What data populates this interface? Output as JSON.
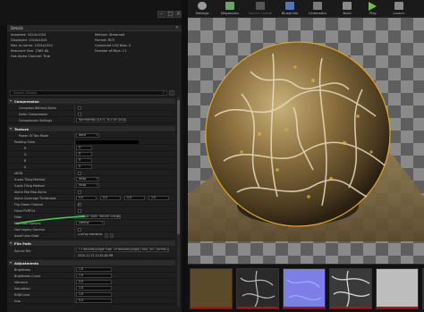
{
  "details_tab": {
    "title": "Details"
  },
  "info": {
    "imported": "Imported: 1024x1024",
    "displayed": "Displayed: 1024x1024",
    "max_ingame": "Max In-Game: 1024x1024",
    "resource_size": "Resource Size: 1365 Kb",
    "has_alpha": "Has Alpha Channel: True",
    "method": "Method: Streamed",
    "format": "Format: BC5",
    "combined_lod": "Combined LOD Bias: 0",
    "num_mips": "Number of Mips: 11"
  },
  "search": {
    "placeholder": "Search Details"
  },
  "sections": {
    "compression": "Compression",
    "texture": "Texture",
    "file_path": "File Path",
    "adjustments": "Adjustments"
  },
  "compression": {
    "rows": [
      {
        "label": "Compress Without Alpha"
      },
      {
        "label": "Defer Compression"
      },
      {
        "label": "Compression Settings",
        "value": "Normalmap (DXT5, BC5 on DX11)"
      }
    ]
  },
  "texture": {
    "rows": [
      {
        "label": "Power Of Two Mode",
        "value": "None"
      },
      {
        "label": "Padding Color",
        "value": ""
      },
      {
        "label": "R",
        "value": "0"
      },
      {
        "label": "G",
        "value": "0"
      },
      {
        "label": "B",
        "value": "0"
      },
      {
        "label": "A",
        "value": "0"
      },
      {
        "label": "sRGB",
        "value": ""
      },
      {
        "label": "X-axis Tiling Method",
        "value": "Wrap"
      },
      {
        "label": "Y-axis Tiling Method",
        "value": "Wrap"
      },
      {
        "label": "Alpha Mip Map Alpha",
        "value": ""
      },
      {
        "label": "Alpha Coverage Thresholds",
        "value": "0.0"
      },
      {
        "label": "Flip Green Channel",
        "value": ""
      },
      {
        "label": "Force PVRTC4",
        "value": ""
      },
      {
        "label": "Filter",
        "value": "Default (from Texture Group)"
      },
      {
        "label": "Mip Load Options",
        "value": "Default"
      },
      {
        "label": "Use Legacy Gamma",
        "value": ""
      },
      {
        "label": "Asset User Data",
        "value": "0 Array elements"
      }
    ],
    "coverage_values": [
      "0.0",
      "0.0",
      "0.0",
      "1.0"
    ]
  },
  "file_path": {
    "label": "Source File",
    "value": "C:/Textures/Jungle Floor 2d textures/Jungle_Floor_001_normal.jpg",
    "date": "2020.11.13 11:32:48 PM"
  },
  "adjustments": {
    "rows": [
      {
        "label": "Brightness",
        "value": "1.0"
      },
      {
        "label": "Brightness Curve",
        "value": "1.0"
      },
      {
        "label": "Vibrance",
        "value": "0.0"
      },
      {
        "label": "Saturation",
        "value": "1.0"
      },
      {
        "label": "RGBCurve",
        "value": "1.0"
      },
      {
        "label": "Hue",
        "value": "0.0"
      }
    ]
  },
  "toolbar": {
    "items": [
      {
        "label": "Settings",
        "icon": "gear-icon",
        "color": "#9a9a9a"
      },
      {
        "label": "Megascans",
        "icon": "megascans-icon",
        "color": "#6fa36a"
      },
      {
        "label": "Source Control",
        "icon": "source-control-icon",
        "color": "#555555"
      },
      {
        "label": "Blueprints",
        "icon": "blueprints-icon",
        "color": "#4f76b8"
      },
      {
        "label": "Cinematics",
        "icon": "cinematics-icon",
        "color": "#7a7a7a"
      },
      {
        "label": "Build",
        "icon": "build-icon",
        "color": "#8a8a8a"
      },
      {
        "label": "Play",
        "icon": "play-icon",
        "color": "#6fbf4a"
      },
      {
        "label": "Launch",
        "icon": "launch-icon",
        "color": "#888888"
      }
    ]
  },
  "colors": {
    "accent_green": "#3fd24a",
    "panel_bg": "#1c1c1c",
    "section_bg": "#2b2b2b",
    "thumb_bar": "#aa1111"
  }
}
